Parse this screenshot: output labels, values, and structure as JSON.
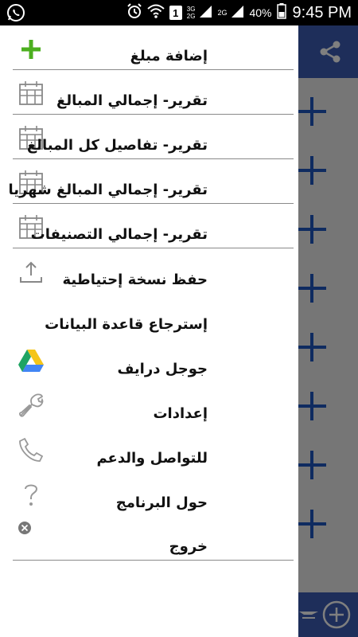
{
  "status_bar": {
    "sim_badge": "1",
    "network_top": "3G",
    "network_bottom": "2G",
    "network_alt": "2G",
    "battery_percent": "40%",
    "time": "9:45 PM",
    "icons": [
      "whatsapp-icon",
      "alarm-icon",
      "wifi-icon",
      "signal-icon",
      "battery-icon"
    ]
  },
  "background_app": {
    "header_color": "#3c5db4",
    "plus_color": "#1e56c0",
    "icons": [
      "share-icon",
      "plus-icon",
      "filter-icon",
      "add-circle-icon"
    ]
  },
  "drawer": {
    "items": [
      {
        "label": "إضافة مبلغ",
        "icon": "plus-icon"
      },
      {
        "label": "تقرير- إجمالي المبالغ",
        "icon": "calendar-icon"
      },
      {
        "label": "تقرير- تفاصيل كل المبالغ",
        "icon": "calendar-icon"
      },
      {
        "label": "تقرير- إجمالي المبالغ شهريا",
        "icon": "calendar-icon"
      },
      {
        "label": "تقرير- إجمالي التصنيفات",
        "icon": "calendar-icon"
      },
      {
        "label": "حفظ نسخة إحتياطية",
        "icon": "upload-icon"
      },
      {
        "label": "إسترجاع قاعدة البيانات",
        "icon": ""
      },
      {
        "label": "جوجل درايف",
        "icon": "google-drive-icon"
      },
      {
        "label": "إعدادات",
        "icon": "wrench-icon"
      },
      {
        "label": "للتواصل والدعم",
        "icon": "phone-icon"
      },
      {
        "label": "حول البرنامج",
        "icon": "question-icon"
      },
      {
        "label": "خروج",
        "icon": "close-circle-icon"
      }
    ],
    "accent_plus_color": "#4caf1f"
  }
}
